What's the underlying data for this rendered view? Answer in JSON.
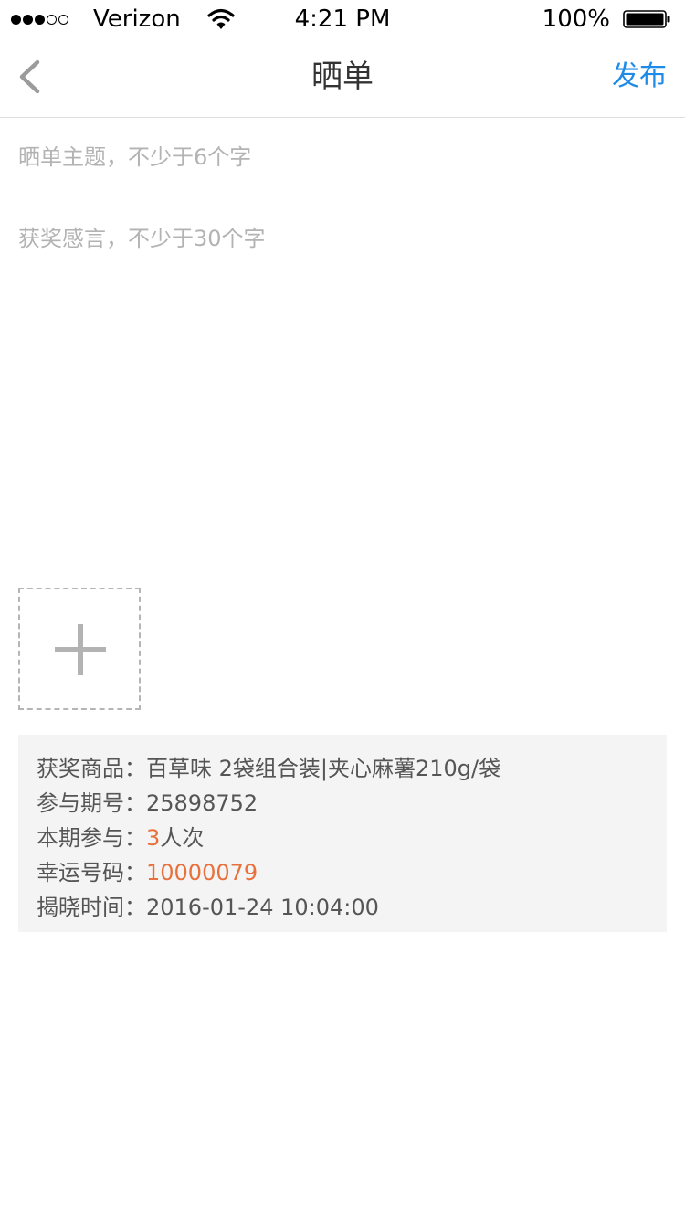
{
  "status_bar": {
    "carrier": "Verizon",
    "time": "4:21 PM",
    "battery": "100%",
    "signal_bars_filled": 3,
    "signal_bars_total": 5,
    "battery_level": 1.0
  },
  "nav": {
    "title": "晒单",
    "publish_label": "发布",
    "accent_color": "#1e8be8"
  },
  "form": {
    "title_placeholder": "晒单主题，不少于6个字",
    "title_value": "",
    "content_placeholder": "获奖感言，不少于30个字",
    "content_value": ""
  },
  "prize_info": {
    "product_label": "获奖商品：",
    "product_value": "百草味 2袋组合装|夹心麻薯210g/袋",
    "issue_label": "参与期号：",
    "issue_value": "25898752",
    "participation_label": "本期参与：",
    "participation_count": "3",
    "participation_unit": "人次",
    "lucky_label": "幸运号码：",
    "lucky_value": "10000079",
    "reveal_label": "揭晓时间：",
    "reveal_value": "2016-01-24 10:04:00",
    "highlight_color": "#e8703a"
  }
}
